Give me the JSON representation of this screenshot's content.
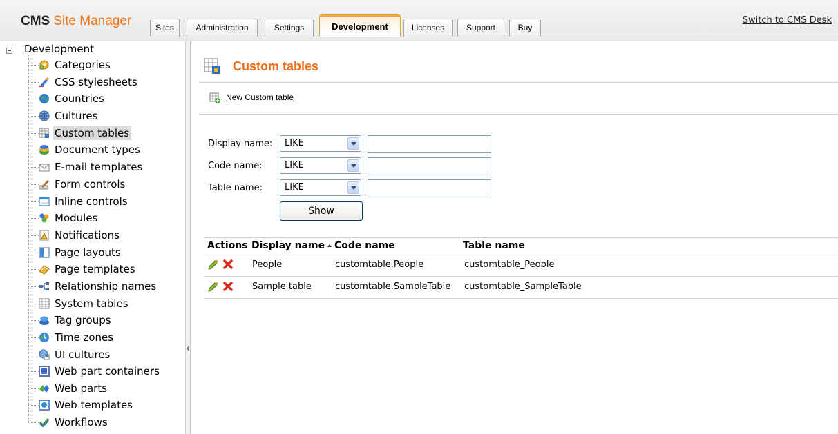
{
  "header": {
    "logo_brand": "CMS",
    "logo_product": "Site Manager",
    "tabs": [
      {
        "label": "Sites"
      },
      {
        "label": "Administration"
      },
      {
        "label": "Settings"
      },
      {
        "label": "Development"
      },
      {
        "label": "Licenses"
      },
      {
        "label": "Support"
      },
      {
        "label": "Buy"
      }
    ],
    "active_tab": "Development",
    "switch_link": "Switch to CMS Desk"
  },
  "tree": {
    "root_label": "Development",
    "items": [
      {
        "label": "Categories",
        "icon": "categories-icon"
      },
      {
        "label": "CSS stylesheets",
        "icon": "css-stylesheets-icon"
      },
      {
        "label": "Countries",
        "icon": "globe-icon"
      },
      {
        "label": "Cultures",
        "icon": "cultures-icon"
      },
      {
        "label": "Custom tables",
        "icon": "custom-tables-icon"
      },
      {
        "label": "Document types",
        "icon": "document-types-icon"
      },
      {
        "label": "E-mail templates",
        "icon": "envelope-icon"
      },
      {
        "label": "Form controls",
        "icon": "form-controls-icon"
      },
      {
        "label": "Inline controls",
        "icon": "inline-controls-icon"
      },
      {
        "label": "Modules",
        "icon": "modules-icon"
      },
      {
        "label": "Notifications",
        "icon": "notifications-icon"
      },
      {
        "label": "Page layouts",
        "icon": "page-layouts-icon"
      },
      {
        "label": "Page templates",
        "icon": "page-templates-icon"
      },
      {
        "label": "Relationship names",
        "icon": "relationship-icon"
      },
      {
        "label": "System tables",
        "icon": "system-tables-icon"
      },
      {
        "label": "Tag groups",
        "icon": "tag-groups-icon"
      },
      {
        "label": "Time zones",
        "icon": "time-zones-icon"
      },
      {
        "label": "UI cultures",
        "icon": "ui-cultures-icon"
      },
      {
        "label": "Web part containers",
        "icon": "web-part-containers-icon"
      },
      {
        "label": "Web parts",
        "icon": "web-parts-icon"
      },
      {
        "label": "Web templates",
        "icon": "web-templates-icon"
      },
      {
        "label": "Workflows",
        "icon": "workflows-icon"
      }
    ],
    "selected": "Custom tables"
  },
  "content": {
    "title": "Custom tables",
    "new_link": "New Custom table",
    "filters": [
      {
        "label": "Display name:",
        "operator": "LIKE",
        "value": ""
      },
      {
        "label": "Code name:",
        "operator": "LIKE",
        "value": ""
      },
      {
        "label": "Table name:",
        "operator": "LIKE",
        "value": ""
      }
    ],
    "show_button": "Show",
    "grid": {
      "columns": [
        "Actions",
        "Display name",
        "Code name",
        "Table name"
      ],
      "sorted_column": "Display name",
      "sort_direction": "ascending",
      "rows": [
        {
          "display_name": "People",
          "code_name": "customtable.People",
          "table_name": "customtable_People"
        },
        {
          "display_name": "Sample table",
          "code_name": "customtable.SampleTable",
          "table_name": "customtable_SampleTable"
        }
      ]
    }
  }
}
